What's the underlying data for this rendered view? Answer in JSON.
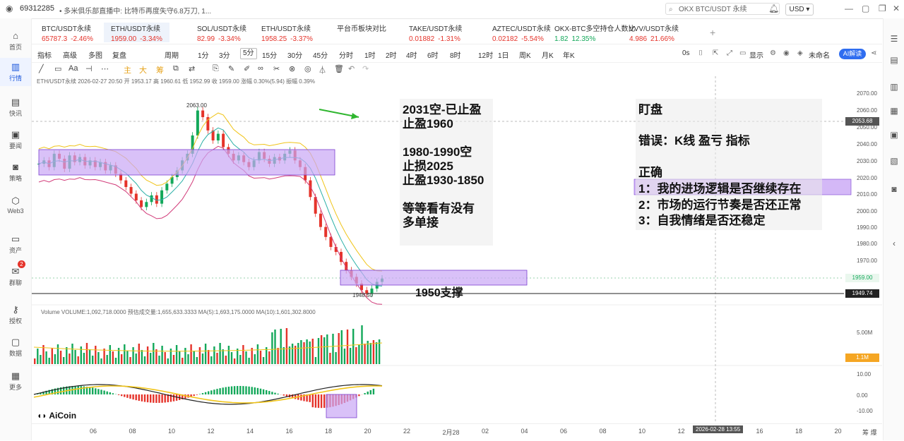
{
  "topbar": {
    "user_id": "69312285",
    "ticker": "• 多米俱乐部直播中:  比特币再度失守6.8万刀, 1...",
    "search_placeholder": "OKX BTC/USDT 永续",
    "currency": "USD"
  },
  "sidebar": {
    "items": [
      {
        "label": "首页",
        "icon": "home-icon"
      },
      {
        "label": "行情",
        "icon": "chart-bars-icon",
        "active": true
      },
      {
        "label": "快讯",
        "icon": "news-icon"
      },
      {
        "label": "要闻",
        "icon": "headline-icon"
      },
      {
        "label": "策略",
        "icon": "robot-icon"
      },
      {
        "label": "Web3",
        "icon": "web3-icon"
      },
      {
        "label": "资产",
        "icon": "wallet-icon"
      },
      {
        "label": "群聊",
        "icon": "chat-icon",
        "badge": "2"
      },
      {
        "label": "授权",
        "icon": "key-icon"
      },
      {
        "label": "数据",
        "icon": "monitor-icon"
      },
      {
        "label": "更多",
        "icon": "grid-icon"
      }
    ]
  },
  "symbols": [
    {
      "name": "BTC/USDT永续",
      "price": "65787.3",
      "change": "-2.46%",
      "dir": "dn"
    },
    {
      "name": "ETH/USDT永续",
      "price": "1959.00",
      "change": "-3.34%",
      "dir": "dn",
      "active": true
    },
    {
      "name": "SOL/USDT永续",
      "price": "82.99",
      "change": "-3.34%",
      "dir": "dn"
    },
    {
      "name": "ETH/USDT永续",
      "price": "1958.25",
      "change": "-3.37%",
      "dir": "dn"
    },
    {
      "name": "平台币板块对比",
      "price": "",
      "change": "",
      "dir": ""
    },
    {
      "name": "TAKE/USDT永续",
      "price": "0.01882",
      "change": "-1.31%",
      "dir": "dn"
    },
    {
      "name": "AZTEC/USDT永续",
      "price": "0.02182",
      "change": "-5.54%",
      "dir": "dn"
    },
    {
      "name": "OKX-BTC多空持仓人数比",
      "price": "1.82",
      "change": "12.35%",
      "dir": "up"
    },
    {
      "name": "VVV/USDT永续",
      "price": "4.986",
      "change": "21.66%",
      "dir": "dn"
    }
  ],
  "toolbar": {
    "left": [
      "指标",
      "高级",
      "多图",
      "复盘",
      "周期"
    ],
    "intervals": [
      "1分",
      "3分",
      "5分",
      "15分",
      "30分",
      "45分",
      "分时",
      "1时",
      "2时",
      "4时",
      "6时",
      "8时",
      "12时",
      "1日",
      "周K",
      "月K",
      "年K"
    ],
    "active_interval": "5分",
    "right": [
      "0s",
      "显示",
      "未命名"
    ],
    "ai_label": "AI解读"
  },
  "draw_tools": [
    "主",
    "大",
    "筹"
  ],
  "chart_info": {
    "ohlc": "ETH/USDT永续  2026-02-27 20:50  开 1953.17  高 1960.61  低 1952.99  收 1959.00  涨幅 0.30%(5.94)  振幅 0.39%",
    "volume": "Volume  VOLUME:1,092,718.0000    预估成交量:1,655,633.3333    MA(5):1,693,175.0000    MA(10):1,601,302.8000",
    "high_label": "2063.00",
    "low_label": "1948.50"
  },
  "price_axis": {
    "ticks": [
      "2070.00",
      "2060.00",
      "2050.00",
      "2040.00",
      "2030.00",
      "2020.00",
      "2010.00",
      "2000.00",
      "1990.00",
      "1980.00",
      "1970.00",
      "1960.00",
      "1950.00"
    ],
    "crosshair_price": "2053.68",
    "last_price": "1959.00",
    "support_price": "1949.74",
    "vol_ticks": [
      "5.00M"
    ],
    "vol_label": "1.1M",
    "macd_ticks": [
      "10.00",
      "0.00",
      "-10.00"
    ]
  },
  "time_axis": {
    "ticks": [
      "06",
      "08",
      "10",
      "12",
      "14",
      "16",
      "18",
      "20",
      "22",
      "2月28",
      "02",
      "04",
      "06",
      "08",
      "10",
      "12",
      "14",
      "16",
      "18",
      "20"
    ],
    "crosshair_time": "2026-02-28 13:55",
    "corner": "筹 爆"
  },
  "annotations": {
    "trade_plan": "2031空-已止盈\n止盈1960\n\n1980-1990空\n止损2025\n止盈1930-1850\n\n等等看有没有\n多单接",
    "support": "1950支撑",
    "watch_title": "盯盘",
    "mistake": "错误：K线 盈亏 指标",
    "correct_title": "正确",
    "point1": "1：我的进场逻辑是否继续存在",
    "point2": "2：市场的运行节奏是否还正常",
    "point3": "3：自我情绪是否还稳定"
  },
  "logo": "AiCoin",
  "colors": {
    "up": "#13a85a",
    "down": "#e5332a",
    "zone": "#c9a6f5",
    "ma_yellow": "#f0c419",
    "ma_teal": "#2bb0a7",
    "boll": "#d23c7a",
    "accent": "#2f6df0"
  }
}
